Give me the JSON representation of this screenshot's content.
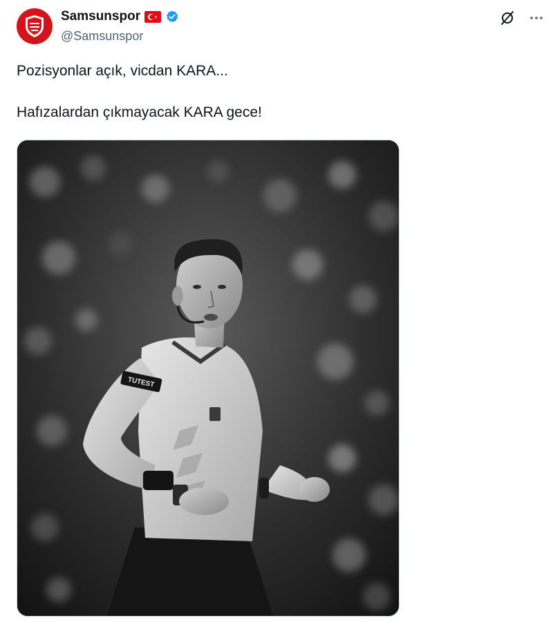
{
  "account": {
    "display_name": "Samsunspor",
    "handle": "@Samsunspor",
    "flag_icon": "turkey-flag-icon",
    "verified_icon": "verified-badge-icon",
    "verified_color": "#1d9bf0",
    "avatar_color": "#d4141b"
  },
  "actions": {
    "grok_icon": "grok-icon",
    "more_icon": "more-horizontal-icon"
  },
  "tweet": {
    "line1": "Pozisyonlar açık, vicdan KARA...",
    "line2": "Hafızalardan çıkmayacak KARA gece!"
  },
  "media": {
    "armband_text": "TUTEST",
    "style": "black-and-white photo of a referee"
  }
}
